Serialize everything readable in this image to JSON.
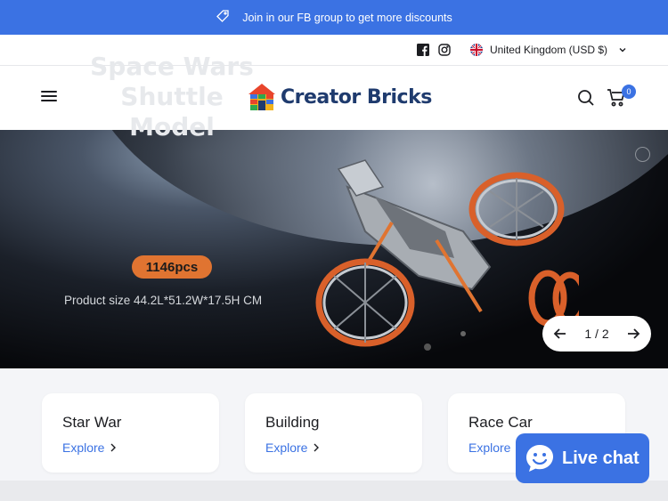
{
  "announcement": {
    "text": "Join in our FB group to get more discounts"
  },
  "topbar": {
    "locale": "United Kingdom (USD $)"
  },
  "header": {
    "logo_text": "Creator Bricks",
    "cart_count": "0"
  },
  "hero": {
    "title_line1": "Space Wars",
    "title_line2": "Shuttle Model",
    "pieces": "1146pcs",
    "size": "Product size 44.2L*51.2W*17.5H CM",
    "slide_indicator": "1 / 2"
  },
  "categories": [
    {
      "title": "Star War",
      "link": "Explore"
    },
    {
      "title": "Building",
      "link": "Explore"
    },
    {
      "title": "Race Car",
      "link": "Explore"
    }
  ],
  "chat": {
    "label": "Live chat"
  },
  "colors": {
    "accent": "#3b72e3",
    "pill": "#e07431"
  }
}
